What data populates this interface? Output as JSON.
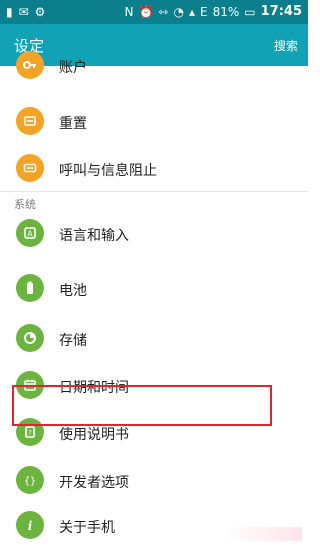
{
  "status_bar": {
    "icons": [
      "sim-icon",
      "mail-icon",
      "app-icon",
      "nfc-icon",
      "alarm-icon",
      "vibrate-icon",
      "wifi-icon",
      "cellular-icon"
    ],
    "signal_label": "E",
    "battery": "81%",
    "time": "17:45"
  },
  "app_bar": {
    "title": "设定",
    "search_label": "搜索"
  },
  "colors": {
    "orange_icon": "#f4a324",
    "green_icon": "#6db33f",
    "accent": "#11a3b5",
    "highlight": "#e2252d"
  },
  "list": {
    "top_items": [
      {
        "label": "账户",
        "icon": "key-icon"
      },
      {
        "label": "重置",
        "icon": "reset-icon"
      },
      {
        "label": "呼叫与信息阻止",
        "icon": "block-icon"
      }
    ],
    "section_title": "系统",
    "system_items": [
      {
        "label": "语言和输入",
        "icon": "language-icon"
      },
      {
        "label": "电池",
        "icon": "battery-icon"
      },
      {
        "label": "存储",
        "icon": "storage-icon"
      },
      {
        "label": "日期和时间",
        "icon": "calendar-icon"
      },
      {
        "label": "使用说明书",
        "icon": "manual-icon"
      },
      {
        "label": "开发者选项",
        "icon": "developer-icon"
      },
      {
        "label": "关于手机",
        "icon": "info-icon"
      }
    ]
  }
}
